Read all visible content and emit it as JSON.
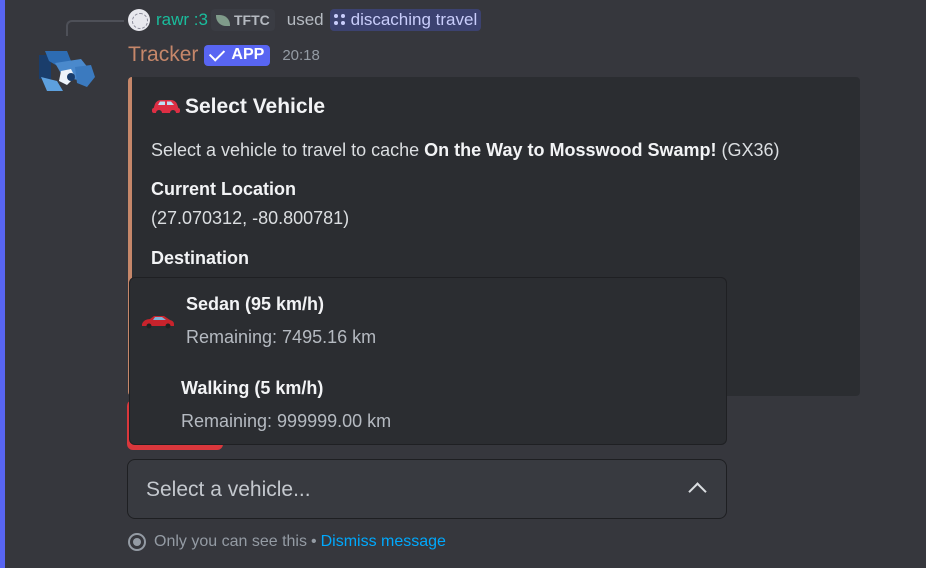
{
  "reply": {
    "user": "rawr :3",
    "tag": "TFTC",
    "used_text": "used",
    "command": "discaching travel"
  },
  "message": {
    "author": "Tracker",
    "badge": "APP",
    "timestamp": "20:18"
  },
  "embed": {
    "title": "Select Vehicle",
    "description_prefix": "Select a vehicle to travel to cache ",
    "cache_name": "On the Way to Mosswood Swamp!",
    "cache_code": " (GX36)",
    "fields": [
      {
        "name": "Current Location",
        "value": "(27.070312, -80.800781)"
      },
      {
        "name": "Destination",
        "value": ""
      }
    ],
    "accent_color": "#c6876a"
  },
  "dropdown": {
    "options": [
      {
        "label": "Sedan (95 km/h)",
        "description": "Remaining: 7495.16 km",
        "icon": "red-car-icon"
      },
      {
        "label": "Walking (5 km/h)",
        "description": "Remaining: 999999.00 km",
        "icon": ""
      }
    ]
  },
  "select": {
    "placeholder": "Select a vehicle..."
  },
  "notice": {
    "text": "Only you can see this",
    "separator": "•",
    "dismiss": "Dismiss message"
  },
  "colors": {
    "background": "#313338",
    "blurple": "#5865f2",
    "link": "#00a8fc",
    "danger": "#da373c"
  }
}
